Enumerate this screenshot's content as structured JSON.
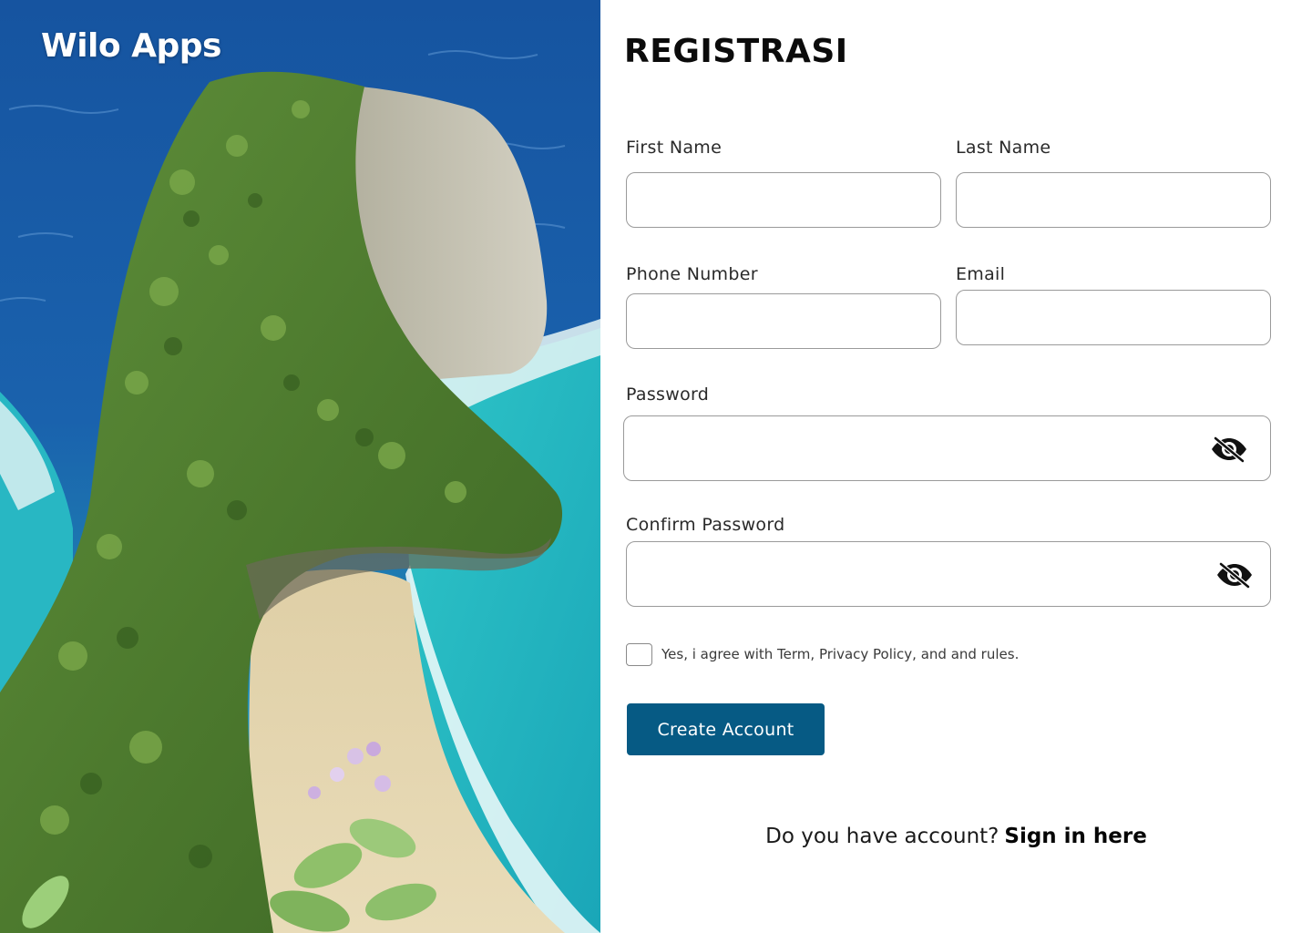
{
  "brand": {
    "name": "Wilo Apps"
  },
  "form": {
    "title": "REGISTRASI",
    "first_name": {
      "label": "First Name",
      "value": "",
      "placeholder": ""
    },
    "last_name": {
      "label": "Last Name",
      "value": "",
      "placeholder": ""
    },
    "phone": {
      "label": "Phone Number",
      "value": "",
      "placeholder": ""
    },
    "email": {
      "label": "Email",
      "value": "",
      "placeholder": ""
    },
    "password": {
      "label": "Password",
      "value": "",
      "placeholder": "",
      "icon": "eye-slash-icon"
    },
    "confirm_password": {
      "label": "Confirm Password",
      "value": "",
      "placeholder": "",
      "icon": "eye-slash-icon"
    },
    "agree": {
      "text": "Yes, i agree with Term, Privacy Policy, and and rules.",
      "checked": false
    },
    "submit_label": "Create Account"
  },
  "signin": {
    "question": "Do you have account?",
    "link": "Sign in here"
  },
  "colors": {
    "primary": "#065a84",
    "border": "#9a9a9a",
    "text": "#1a1a1a"
  }
}
